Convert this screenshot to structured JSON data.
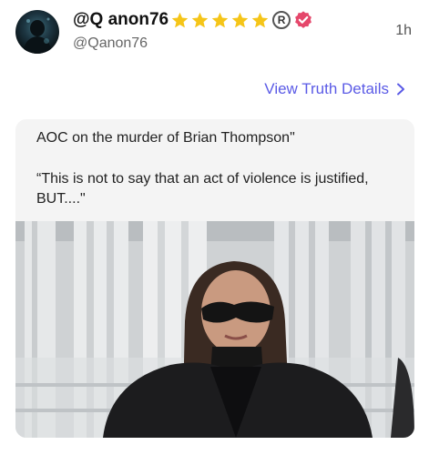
{
  "post": {
    "display_name": "@Q anon76",
    "handle": "@Qanon76",
    "timestamp": "1h",
    "star_count": 5,
    "view_link_label": "View Truth Details"
  },
  "card": {
    "headline": "AOC on the murder of Brian Thompson\"",
    "quote": "“This is not to say that an act of violence is justified, BUT....\""
  },
  "colors": {
    "link": "#5b5be6",
    "star": "#f5c518",
    "verified": "#e5476b"
  },
  "icons": [
    "avatar",
    "star-icon",
    "registered-icon",
    "verified-icon",
    "chevron-right-icon"
  ]
}
